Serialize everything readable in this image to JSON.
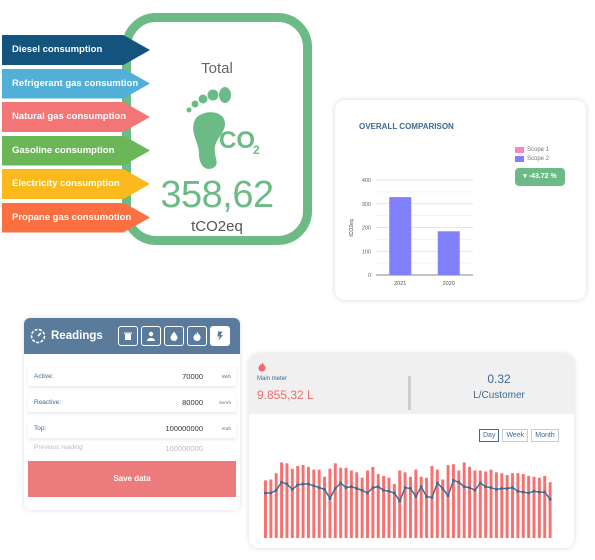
{
  "total": {
    "label": "Total",
    "co2_text": "CO",
    "co2_sub": "2",
    "value": "358,62",
    "unit": "tCO2eq",
    "color": "#6cbb86"
  },
  "categories": [
    {
      "label": "Diesel consumption",
      "color": "#14537e"
    },
    {
      "label": "Refrigerant gas consumtion",
      "color": "#52b0d8"
    },
    {
      "label": "Natural gas consumption",
      "color": "#f47575"
    },
    {
      "label": "Gasoline consumption",
      "color": "#6bb757"
    },
    {
      "label": "Electricity consumption",
      "color": "#fbb91d"
    },
    {
      "label": "Propane gas consumotion",
      "color": "#fb6f41"
    }
  ],
  "comparison": {
    "title": "OVERALL COMPARISON",
    "legend": [
      {
        "label": "Scope 1",
        "color": "#f786c8"
      },
      {
        "label": "Scope 2",
        "color": "#8080fb"
      }
    ],
    "delta": "-43.72 %",
    "delta_icon": "caret-down"
  },
  "readings": {
    "title": "Readings",
    "tabs": [
      {
        "icon": "trash-icon",
        "active": false
      },
      {
        "icon": "user-icon",
        "active": false
      },
      {
        "icon": "water-drop-icon",
        "active": false
      },
      {
        "icon": "flame-icon",
        "active": false
      },
      {
        "icon": "lightning-icon",
        "active": true
      }
    ],
    "rows": [
      {
        "label": "Active:",
        "value": "70000",
        "unit": "kWh"
      },
      {
        "label": "Reactive:",
        "value": "80000",
        "unit": "kvArh"
      },
      {
        "label": "Top:",
        "value": "100000000",
        "unit": "Kwh"
      }
    ],
    "previous": {
      "label": "Previous reading",
      "value": "100000000"
    },
    "save_label": "Save data"
  },
  "meter": {
    "icon": "flame-icon",
    "label": "Main meter",
    "value": "9.855,32 L",
    "ratio_value": "0.32",
    "ratio_unit": "L/Customer",
    "periods": [
      {
        "label": "Day",
        "active": true
      },
      {
        "label": "Week",
        "active": false
      },
      {
        "label": "Month",
        "active": false
      }
    ]
  },
  "chart_data": [
    {
      "type": "bar",
      "title": "OVERALL COMPARISON",
      "categories": [
        "2021",
        "2020"
      ],
      "series": [
        {
          "name": "Scope 2",
          "values": [
            328,
            184
          ]
        }
      ],
      "xlabel": "",
      "ylabel": "tCO2eq",
      "ylim": [
        0,
        400
      ],
      "yticks": [
        0,
        100,
        200,
        300,
        400
      ],
      "grid": true,
      "legend": "top-right"
    },
    {
      "type": "bar",
      "title": "",
      "categories": [],
      "series": [
        {
          "name": "bars",
          "values": [
            64,
            65,
            72,
            84,
            83,
            77,
            80,
            81,
            79,
            76,
            76,
            68,
            77,
            83,
            78,
            78,
            75,
            73,
            67,
            75,
            79,
            71,
            69,
            67,
            60,
            75,
            73,
            68,
            76,
            68,
            67,
            80,
            76,
            65,
            81,
            82,
            75,
            84,
            79,
            75,
            75,
            74,
            76,
            73,
            72,
            70,
            72,
            72,
            71,
            69,
            68,
            67,
            69,
            62
          ]
        },
        {
          "name": "line",
          "values": [
            50,
            50,
            53,
            62,
            60,
            54,
            59,
            60,
            60,
            58,
            56,
            54,
            44,
            55,
            61,
            56,
            57,
            55,
            53,
            50,
            56,
            57,
            53,
            52,
            50,
            41,
            56,
            55,
            46,
            57,
            46,
            45,
            61,
            55,
            47,
            64,
            62,
            57,
            56,
            53,
            61,
            57,
            56,
            54,
            55,
            55,
            56,
            52,
            51,
            50,
            52,
            51,
            51,
            43
          ]
        }
      ],
      "ylim": [
        0,
        100
      ],
      "colors": {
        "bars": "#f87171",
        "line": "#3f6d91"
      }
    }
  ]
}
